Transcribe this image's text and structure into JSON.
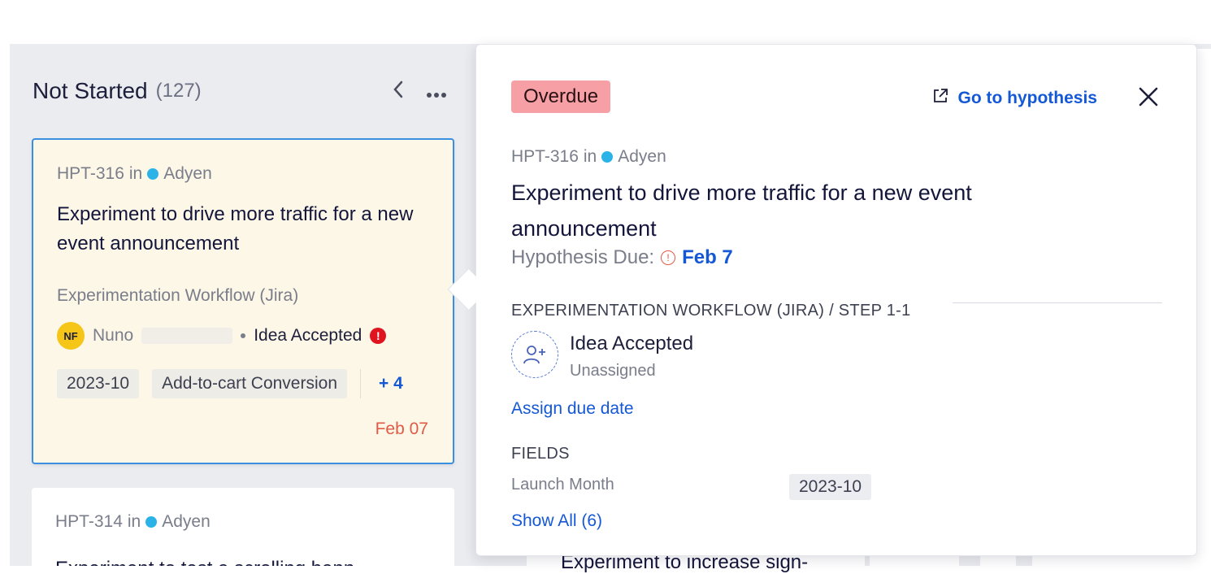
{
  "column": {
    "title": "Not Started",
    "count": "(127)",
    "collapse_icon": "chevron-left-icon",
    "more_icon": "more-horizontal-icon"
  },
  "active_card": {
    "key": "HPT-316",
    "in_label": "in",
    "project": "Adyen",
    "title": "Experiment to drive more traffic for a new event announcement",
    "workflow": "Experimentation Workflow (Jira)",
    "assignee_initials": "NF",
    "assignee_name": "Nuno",
    "status": "Idea Accepted",
    "alert": "!",
    "tags": [
      "2023-10",
      "Add-to-cart Conversion"
    ],
    "more_tags": "+ 4",
    "due": "Feb 07"
  },
  "second_card": {
    "key": "HPT-314",
    "in_label": "in",
    "project": "Adyen",
    "title": "Experiment to test a scrolling bann"
  },
  "background": {
    "bottom_title": "Experiment to increase sign-"
  },
  "popover": {
    "badge": "Overdue",
    "goto_label": "Go to hypothesis",
    "key": "HPT-316",
    "in_label": "in",
    "project": "Adyen",
    "title": "Experiment to drive more traffic for a new event announcement",
    "due_label": "Hypothesis Due:",
    "due_date": "Feb 7",
    "step_heading": "EXPERIMENTATION WORKFLOW (JIRA) / STEP 1-1",
    "step_name": "Idea Accepted",
    "step_assignee": "Unassigned",
    "assign_due": "Assign due date",
    "fields_heading": "FIELDS",
    "field_label": "Launch Month",
    "field_value": "2023-10",
    "show_all": "Show All (6)"
  },
  "colors": {
    "accent": "#1558d6",
    "overdue": "#f6a0a6",
    "card_bg": "#fdf7e8",
    "due_red": "#e05a47",
    "project_dot": "#2bb3e8",
    "avatar": "#f5c518"
  }
}
